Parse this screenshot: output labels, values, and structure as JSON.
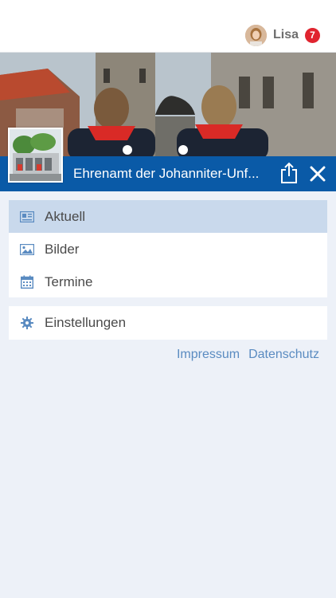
{
  "header": {
    "user_name": "Lisa",
    "notification_count": "7"
  },
  "organization": {
    "title": "Ehrenamt der Johanniter-Unf..."
  },
  "menu": {
    "items": [
      {
        "label": "Aktuell",
        "icon": "news-icon",
        "active": true
      },
      {
        "label": "Bilder",
        "icon": "image-icon",
        "active": false
      },
      {
        "label": "Termine",
        "icon": "calendar-icon",
        "active": false
      }
    ],
    "settings": {
      "label": "Einstellungen",
      "icon": "gear-icon"
    }
  },
  "footer": {
    "impressum": "Impressum",
    "datenschutz": "Datenschutz"
  },
  "colors": {
    "brand_blue": "#0a5aa7",
    "active_item_bg": "#c9d9ec",
    "page_bg": "#edf1f8",
    "badge_red": "#e0242f",
    "link_blue": "#5a8bc1"
  }
}
